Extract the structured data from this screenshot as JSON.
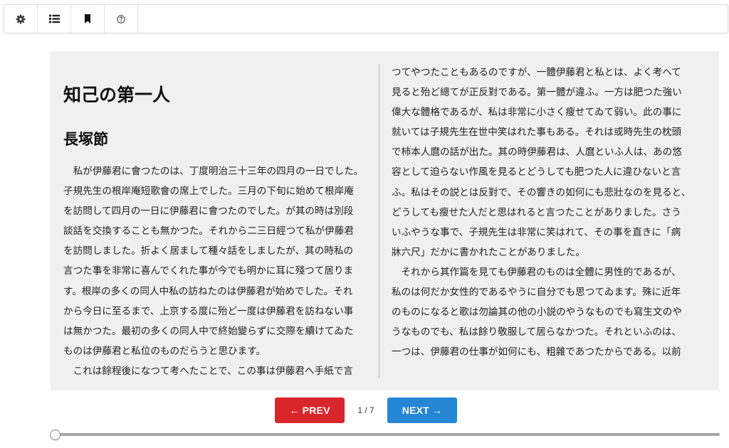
{
  "toolbar": {
    "buttons": [
      {
        "icon": "gear-icon"
      },
      {
        "icon": "list-icon"
      },
      {
        "icon": "bookmark-icon"
      },
      {
        "icon": "help-icon"
      }
    ]
  },
  "page": {
    "title": "知己の第一人",
    "author": "長塚節",
    "left_lines": [
      "　私が伊藤君に會つたのは、丁度明治三十三年の四月の一日でした。",
      "子規先生の根岸庵短歌會の席上でした。三月の下旬に始めて根岸庵",
      "を訪問して四月の一日に伊藤君に會つたのでした。が其の時は別段",
      "談話を交換することも無かつた。それから二三日經つて私が伊藤君",
      "を訪問しました。折よく居まして種々話をしましたが、其の時私の",
      "言つた事を非常に喜んでくれた事が今でも明かに耳に殘つて居りま",
      "す。根岸の多くの同人中私の訪ねたのは伊藤君が始めでした。それ",
      "から今日に至るまで、上京する度に殆ど一度は伊藤君を訪ねない事",
      "は無かつた。最初の多くの同人中で終始變らずに交際を續けてゐた",
      "ものは伊藤君と私位のものだらうと思ひます。",
      "　これは餘程後になつて考へたことで、この事は伊藤君へ手紙で言"
    ],
    "right_lines": [
      "つてやつたこともあるのですが、一體伊藤君と私とは、よく考へて",
      "見ると殆ど總てが正反對である。第一體が違ふ。一方は肥つた強い",
      "偉大な體格であるが、私は非常に小さく瘦せてゐて弱い。此の事に",
      "就いては子規先生在世中笑はれた事もある。それは或時先生の枕頭",
      "で柿本人麿の話が出た。其の時伊藤君は、人麿といふ人は、あの悠",
      "容として迫らない作風を見るとどうしても肥つた人に違ひないと言",
      "ふ。私はその説とは反對で、その響きの如何にも悲壯なのを見ると、",
      "どうしても瘦せた人だと思はれると言つたことがありました。さう",
      "いふやうな事で、子規先生は非常に笑はれて、その事を直きに「病",
      "牀六尺」だかに書かれたことがありました。",
      "　それから其作篇を見ても伊藤君のものは全體に男性的であるが、",
      "私のは何だか女性的であるやうに自分でも思つてゐます。殊に近年",
      "のものになると歌は勿論其の他の小説のやうなものでも寫生文のや",
      "うなものでも、私は餘り敬服して居らなかつた。それといふのは、",
      "一つは、伊藤君の仕事が如何にも、粗雜であつたからである。以前"
    ]
  },
  "pager": {
    "prev_label": "← PREV",
    "next_label": "NEXT →",
    "page_indicator": "1 / 7",
    "prev_color": "#d9262a",
    "next_color": "#2486d4"
  },
  "progress": {
    "value": 0
  }
}
